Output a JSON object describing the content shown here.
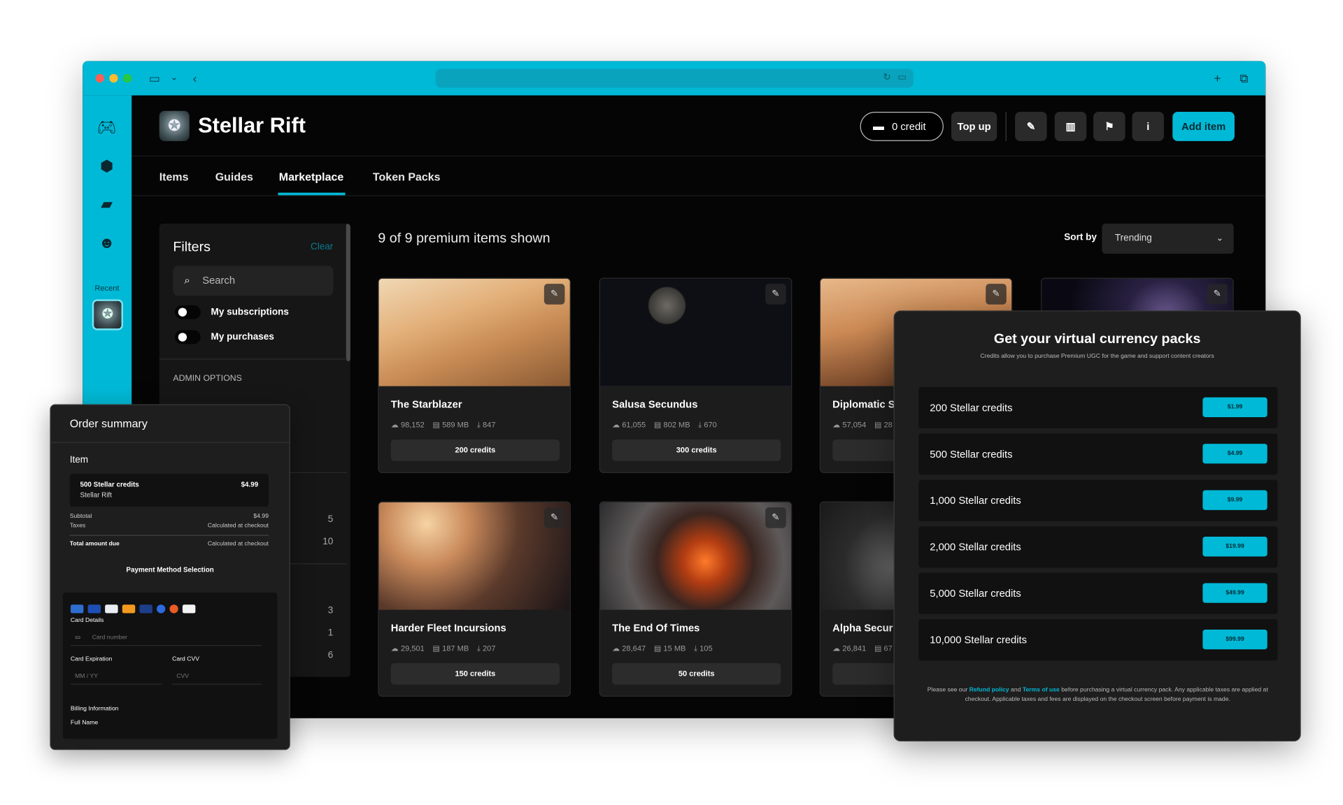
{
  "app": {
    "title": "Stellar Rift"
  },
  "header": {
    "credits": "0 credit",
    "topup": "Top up",
    "add_item": "Add item"
  },
  "tabs": [
    {
      "label": "Items"
    },
    {
      "label": "Guides"
    },
    {
      "label": "Marketplace"
    },
    {
      "label": "Token Packs"
    }
  ],
  "sidebar": {
    "recent": "Recent"
  },
  "filters": {
    "title": "Filters",
    "clear": "Clear",
    "search_placeholder": "Search",
    "toggles": [
      "My subscriptions",
      "My purchases"
    ],
    "admin": "ADMIN OPTIONS",
    "numbers": [
      "5",
      "10",
      "3",
      "1",
      "6"
    ]
  },
  "listing": {
    "count_text": "9 of 9 premium items shown",
    "sort_label": "Sort by",
    "sort_value": "Trending"
  },
  "cards": [
    {
      "title": "The Starblazer",
      "downloads": "98,152",
      "size": "589 MB",
      "installs": "847",
      "price": "200 credits"
    },
    {
      "title": "Salusa Secundus",
      "downloads": "61,055",
      "size": "802 MB",
      "installs": "670",
      "price": "300 credits"
    },
    {
      "title": "Diplomatic S",
      "downloads": "57,054",
      "size": "28",
      "installs": "",
      "price": ""
    },
    {
      "title": "",
      "downloads": "",
      "size": "",
      "installs": "",
      "price": ""
    },
    {
      "title": "Harder Fleet Incursions",
      "downloads": "29,501",
      "size": "187 MB",
      "installs": "207",
      "price": "150 credits"
    },
    {
      "title": "The End Of Times",
      "downloads": "28,647",
      "size": "15 MB",
      "installs": "105",
      "price": "50 credits"
    },
    {
      "title": "Alpha Secur",
      "downloads": "26,841",
      "size": "67",
      "installs": "",
      "price": ""
    }
  ],
  "order": {
    "title": "Order summary",
    "item_label": "Item",
    "item_name": "500 Stellar credits",
    "item_game": "Stellar Rift",
    "item_price": "$4.99",
    "subtotal_label": "Subtotal",
    "subtotal": "$4.99",
    "taxes_label": "Taxes",
    "taxes": "Calculated at checkout",
    "total_label": "Total amount due",
    "total": "Calculated at checkout",
    "payment_title": "Payment Method Selection",
    "card_details": "Card Details",
    "card_number_ph": "Card number",
    "expiration_label": "Card Expiration",
    "expiration_ph": "MM / YY",
    "cvv_label": "Card CVV",
    "cvv_ph": "CVV",
    "billing_label": "Billing Information",
    "fullname_label": "Full Name"
  },
  "packs": {
    "title": "Get your virtual currency packs",
    "subtitle": "Credits allow you to purchase Premium UGC for the game and support content creators",
    "items": [
      {
        "name": "200 Stellar credits",
        "price": "$1.99"
      },
      {
        "name": "500 Stellar credits",
        "price": "$4.99"
      },
      {
        "name": "1,000 Stellar credits",
        "price": "$9.99"
      },
      {
        "name": "2,000 Stellar credits",
        "price": "$19.99"
      },
      {
        "name": "5,000 Stellar credits",
        "price": "$49.99"
      },
      {
        "name": "10,000 Stellar credits",
        "price": "$99.99"
      }
    ],
    "footer_a": "Please see our",
    "refund": "Refund policy",
    "and": "and",
    "terms": "Terms of use",
    "footer_b": "before purchasing a virtual currency pack. Any applicable taxes are applied at checkout. Applicable taxes and fees are displayed on the checkout screen before payment is made."
  },
  "colors": {
    "accent": "#00b9d6",
    "background": "#050505",
    "panel": "#1e1e1e"
  }
}
